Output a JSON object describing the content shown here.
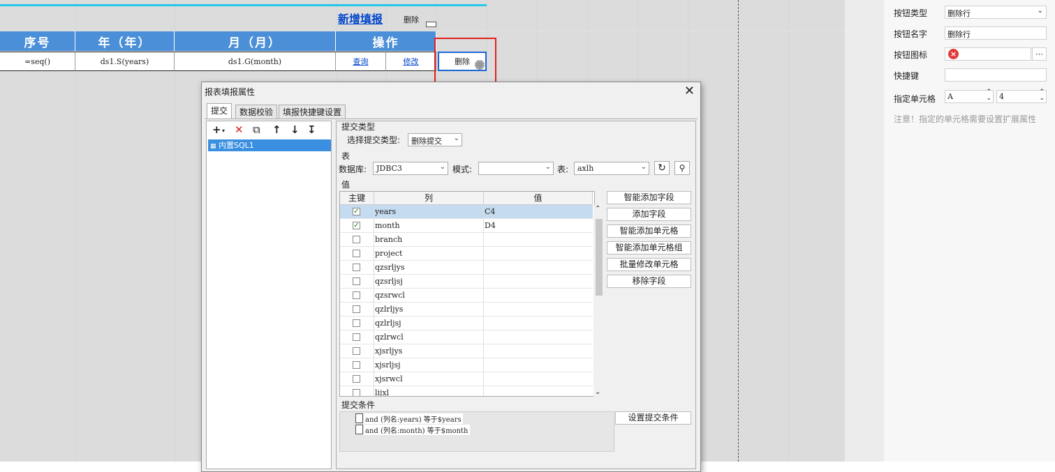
{
  "sheet": {
    "new_fill_link": "新增填报",
    "small_delete": "删除",
    "headers": [
      "序号",
      "年（年）",
      "月（月）",
      "操作"
    ],
    "row": {
      "seq": "=seq()",
      "years": "ds1.S(years)",
      "month": "ds1.G(month)",
      "query": "查询",
      "edit": "修改",
      "delete": "删除"
    }
  },
  "panel": {
    "button_type_label": "按钮类型",
    "button_type_value": "删除行",
    "button_name_label": "按钮名字",
    "button_name_value": "删除行",
    "button_icon_label": "按钮图标",
    "shortcut_label": "快捷键",
    "shortcut_value": "",
    "cell_label": "指定单元格",
    "cell_col": "A",
    "cell_row": "4",
    "note": "注意！指定的单元格需要设置扩展属性"
  },
  "dialog": {
    "title": "报表填报属性",
    "tabs": [
      "提交",
      "数据校验",
      "填报快捷键设置"
    ],
    "tree_item": "内置SQL1",
    "submit_type_section": "提交类型",
    "submit_type_label": "选择提交类型:",
    "submit_type_value": "删除提交",
    "table_section": "表",
    "db_label": "数据库:",
    "db_value": "JDBC3",
    "schema_label": "模式:",
    "schema_value": "",
    "table_label": "表:",
    "table_value": "axlh",
    "value_section": "值",
    "grid_headers": [
      "主键",
      "列",
      "值"
    ],
    "rows": [
      {
        "key": true,
        "col": "years",
        "val": "C4"
      },
      {
        "key": true,
        "col": "month",
        "val": "D4"
      },
      {
        "key": false,
        "col": "branch",
        "val": ""
      },
      {
        "key": false,
        "col": "project",
        "val": ""
      },
      {
        "key": false,
        "col": "qzsrljys",
        "val": ""
      },
      {
        "key": false,
        "col": "qzsrljsj",
        "val": ""
      },
      {
        "key": false,
        "col": "qzsrwcl",
        "val": ""
      },
      {
        "key": false,
        "col": "qzlrljys",
        "val": ""
      },
      {
        "key": false,
        "col": "qzlrljsj",
        "val": ""
      },
      {
        "key": false,
        "col": "qzlrwcl",
        "val": ""
      },
      {
        "key": false,
        "col": "xjsrljys",
        "val": ""
      },
      {
        "key": false,
        "col": "xjsrljsj",
        "val": ""
      },
      {
        "key": false,
        "col": "xjsrwcl",
        "val": ""
      },
      {
        "key": false,
        "col": "lijxl",
        "val": ""
      }
    ],
    "side_buttons": [
      "智能添加字段",
      "添加字段",
      "智能添加单元格",
      "智能添加单元格组",
      "批量修改单元格",
      "移除字段"
    ],
    "cond_section": "提交条件",
    "conditions": [
      "and (列名:years) 等于$years",
      "and (列名:month) 等于$month"
    ],
    "set_cond_button": "设置提交条件"
  }
}
